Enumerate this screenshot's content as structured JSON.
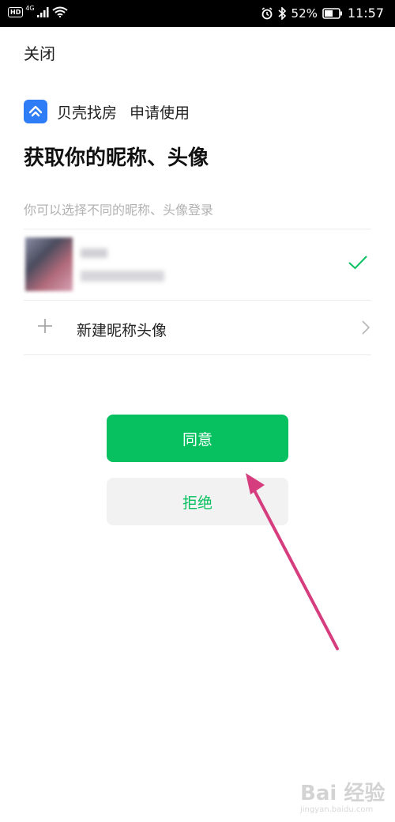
{
  "status_bar": {
    "hd": "HD",
    "network": "4G",
    "battery_percent": "52%",
    "time": "11:57"
  },
  "header": {
    "close_label": "关闭"
  },
  "app": {
    "name": "贝壳找房",
    "action": "申请使用",
    "brand_color": "#2e7df6"
  },
  "page": {
    "title": "获取你的昵称、头像",
    "hint": "你可以选择不同的昵称、头像登录"
  },
  "accounts": {
    "new_label": "新建昵称头像"
  },
  "buttons": {
    "agree": "同意",
    "reject": "拒绝",
    "accent_color": "#07c160"
  },
  "watermark": {
    "text": "Bai 经验",
    "sub": "jingyan.baidu.com"
  }
}
